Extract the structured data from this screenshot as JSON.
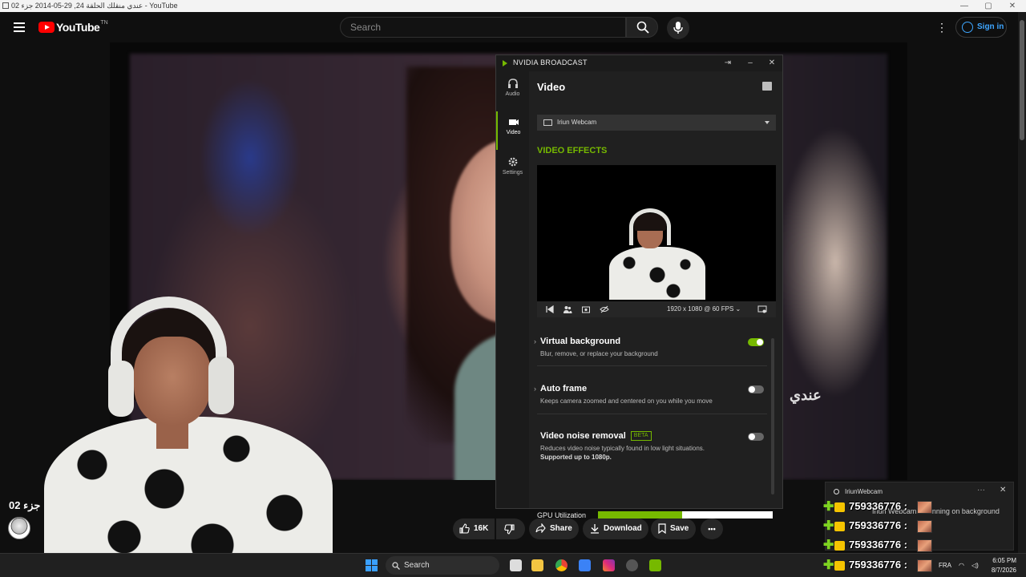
{
  "window": {
    "title": "عندي منقلك الحلقة 24, 29-05-2014 جزء 02 - YouTube",
    "minimize": "—",
    "maximize": "▢",
    "close": "✕"
  },
  "youtube": {
    "logo_text": "YouTube",
    "logo_tm": "TN",
    "search_placeholder": "Search",
    "sign_in": "Sign in",
    "more": "⋮",
    "video_title": "جزء 02",
    "video_overlay_text": "عندي",
    "actions": {
      "likes": "16K",
      "share": "Share",
      "download": "Download",
      "save": "Save",
      "more": "•••"
    }
  },
  "nvidia": {
    "app_title": "NVIDIA BROADCAST",
    "sidebar": [
      {
        "label": "Audio",
        "icon": "headphones-icon"
      },
      {
        "label": "Video",
        "icon": "video-camera-icon",
        "active": true
      },
      {
        "label": "Settings",
        "icon": "gear-icon"
      }
    ],
    "section_title": "Video",
    "device": "Iriun Webcam",
    "effects_heading": "VIDEO EFFECTS",
    "resolution": "1920 x 1080 @ 60 FPS",
    "effects": [
      {
        "name": "Virtual background",
        "desc": "Blur, remove, or replace your background",
        "enabled": true
      },
      {
        "name": "Auto frame",
        "desc": "Keeps camera zoomed and centered on you while you move",
        "enabled": false
      },
      {
        "name": "Video noise removal",
        "badge": "BETA",
        "desc": "Reduces video noise typically found in low light situations.",
        "desc_bold": "Supported up to 1080p.",
        "enabled": false
      }
    ],
    "gpu_label": "GPU Utilization",
    "gpu_utilization_fraction": 0.48,
    "accent_color": "#76b900"
  },
  "notification": {
    "source": "IriunWebcam",
    "message": "Iriun Webcam is running on background",
    "more": "···",
    "close": "✕"
  },
  "chat": [
    {
      "text": "759336776 :"
    },
    {
      "text": "759336776 :"
    },
    {
      "text": "759336776 :"
    },
    {
      "text": "759336776 :"
    }
  ],
  "taskbar": {
    "search": "Search",
    "language": "FRA",
    "time": "6:05 PM",
    "date": "8/7/2026"
  }
}
